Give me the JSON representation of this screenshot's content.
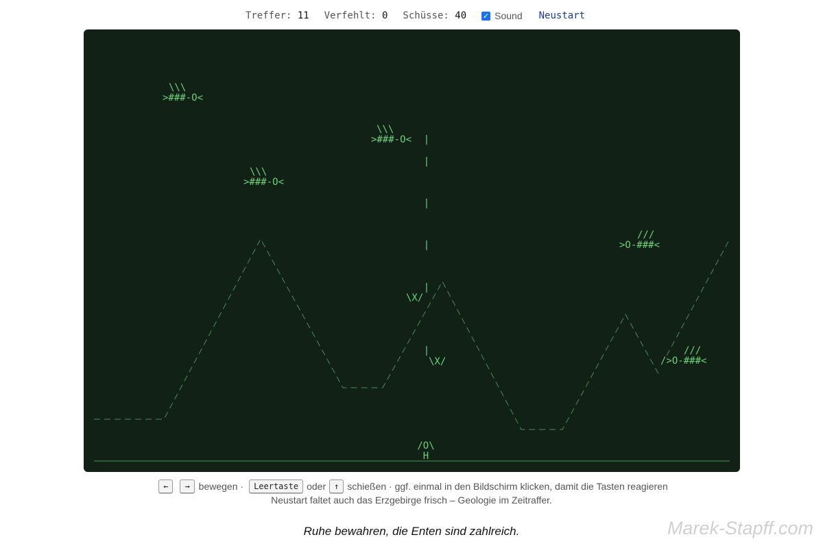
{
  "status": {
    "hits_label": "Treffer:",
    "hits": "11",
    "misses_label": "Verfehlt:",
    "misses": "0",
    "shots_label": "Schüsse:",
    "shots": "40",
    "sound_label": "Sound",
    "sound_checked": true,
    "restart_label": "Neustart"
  },
  "game": {
    "ducks": [
      {
        "id": "duck-1",
        "dir": "left",
        "wings": "\\\\\\",
        "body": ">###-O<"
      },
      {
        "id": "duck-2",
        "dir": "left",
        "wings": "\\\\\\",
        "body": ">###-O<"
      },
      {
        "id": "duck-3",
        "dir": "left",
        "wings": "\\\\\\",
        "body": ">###-O<"
      },
      {
        "id": "duck-4",
        "dir": "right",
        "wings": "///",
        "body": ">O-###<"
      },
      {
        "id": "duck-5",
        "dir": "right",
        "wings": "///",
        "body": "/>O-###<"
      }
    ],
    "bullet_glyph": "|",
    "hit_marker": "\\X/",
    "hunter_head": "/O\\",
    "hunter_body": "H"
  },
  "help": {
    "key_left": "←",
    "key_right": "→",
    "move": "bewegen ·",
    "key_space": "Leertaste",
    "or": "oder",
    "key_up": "↑",
    "shoot_hint": "schießen · ggf. einmal in den Bildschirm klicken, damit die Tasten reagieren",
    "line2": "Neustart faltet auch das Erzgebirge frisch – Geologie im Zeitraffer."
  },
  "caption": "Ruhe bewahren, die Enten sind zahlreich.",
  "watermark": "Marek-Stapff.com",
  "colors": {
    "screen_bg": "#122116",
    "phosphor": "#6fd07c",
    "mountains": "#4f8a59",
    "ground": "#4c9456",
    "checkbox": "#1a73e8",
    "link": "#1a3a9c"
  }
}
